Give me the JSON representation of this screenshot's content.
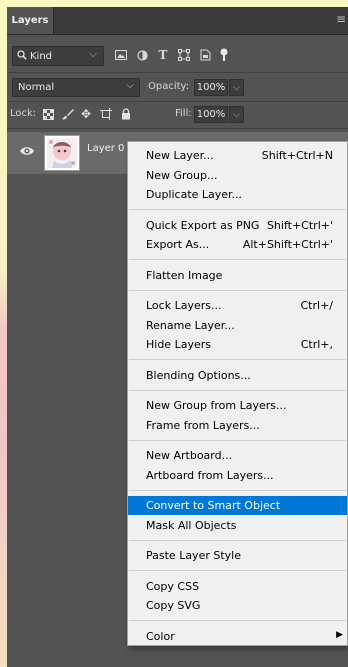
{
  "panel": {
    "tab_label": "Layers",
    "menu_icon": "hamburger-icon"
  },
  "filter": {
    "kind_label": "Kind",
    "icons": [
      "image-filter-icon",
      "adjustment-filter-icon",
      "type-filter-icon",
      "shape-filter-icon",
      "smart-object-filter-icon",
      "filter-toggle-icon"
    ]
  },
  "blend": {
    "mode": "Normal",
    "opacity_label": "Opacity:",
    "opacity_value": "100%"
  },
  "lock": {
    "label": "Lock:",
    "fill_label": "Fill:",
    "fill_value": "100%"
  },
  "layer": {
    "name": "Layer 0",
    "visible": true
  },
  "menu": {
    "groups": [
      [
        {
          "label": "New Layer...",
          "shortcut": "Shift+Ctrl+N"
        },
        {
          "label": "New Group...",
          "shortcut": ""
        },
        {
          "label": "Duplicate Layer...",
          "shortcut": ""
        }
      ],
      [
        {
          "label": "Quick Export as PNG",
          "shortcut": "Shift+Ctrl+'"
        },
        {
          "label": "Export As...",
          "shortcut": "Alt+Shift+Ctrl+'"
        }
      ],
      [
        {
          "label": "Flatten Image",
          "shortcut": ""
        }
      ],
      [
        {
          "label": "Lock Layers...",
          "shortcut": "Ctrl+/"
        },
        {
          "label": "Rename Layer...",
          "shortcut": ""
        },
        {
          "label": "Hide Layers",
          "shortcut": "Ctrl+,"
        }
      ],
      [
        {
          "label": "Blending Options...",
          "shortcut": ""
        }
      ],
      [
        {
          "label": "New Group from Layers...",
          "shortcut": ""
        },
        {
          "label": "Frame from Layers...",
          "shortcut": ""
        }
      ],
      [
        {
          "label": "New Artboard...",
          "shortcut": ""
        },
        {
          "label": "Artboard from Layers...",
          "shortcut": ""
        }
      ],
      [
        {
          "label": "Convert to Smart Object",
          "shortcut": "",
          "highlighted": true
        },
        {
          "label": "Mask All Objects",
          "shortcut": ""
        }
      ],
      [
        {
          "label": "Paste Layer Style",
          "shortcut": ""
        }
      ],
      [
        {
          "label": "Copy CSS",
          "shortcut": ""
        },
        {
          "label": "Copy SVG",
          "shortcut": ""
        }
      ],
      [
        {
          "label": "Color",
          "shortcut": "",
          "submenu": true
        }
      ]
    ]
  },
  "colors": {
    "panel_bg": "#535353",
    "menu_bg": "#f0f0f0",
    "highlight": "#0078d7"
  }
}
